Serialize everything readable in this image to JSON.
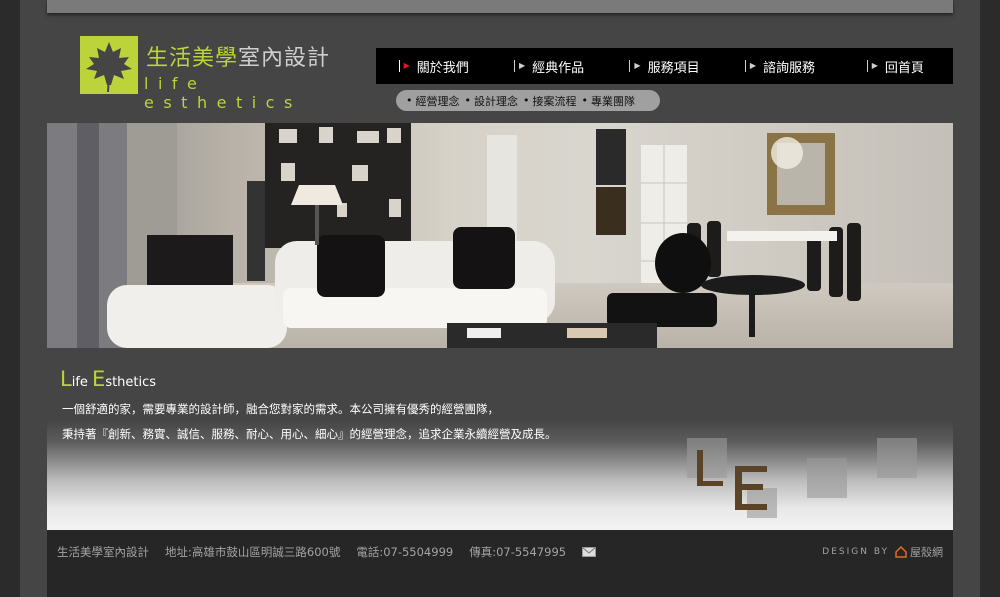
{
  "logo": {
    "cn_green": "生活美學",
    "cn_gray": "室內設計",
    "en": "life esthetics"
  },
  "nav": {
    "items": [
      {
        "label": "關於我們",
        "active": true
      },
      {
        "label": "經典作品"
      },
      {
        "label": "服務項目"
      },
      {
        "label": "諮詢服務"
      },
      {
        "label": "回首頁"
      }
    ]
  },
  "subnav": {
    "items": [
      "經營理念",
      "設計理念",
      "接案流程",
      "專業團隊"
    ]
  },
  "about": {
    "title_L": "L",
    "title_ife": "ife ",
    "title_E": "E",
    "title_sthetics": "sthetics",
    "line1": "一個舒適的家，需要專業的設計師，融合您對家的需求。本公司擁有優秀的經營團隊，",
    "line2": "秉持著『創新、務實、誠信、服務、耐心、用心、細心』的經營理念，追求企業永續經營及成長。"
  },
  "footer": {
    "company": "生活美學室內設計",
    "address": "地址:高雄市鼓山區明誠三路600號",
    "phone": "電話:07-5504999",
    "fax": "傳真:07-5547995",
    "credit_label": "DESIGN BY",
    "credit_site": "屋殼網"
  },
  "colors": {
    "accent": "#bcd33a",
    "nav_bg": "#000000",
    "page_bg": "#454545",
    "marker_red": "#e0161e"
  },
  "icons": {
    "mail": "envelope-icon",
    "nav_marker": "triangle-marker-icon",
    "logo": "maple-leaf-icon"
  }
}
